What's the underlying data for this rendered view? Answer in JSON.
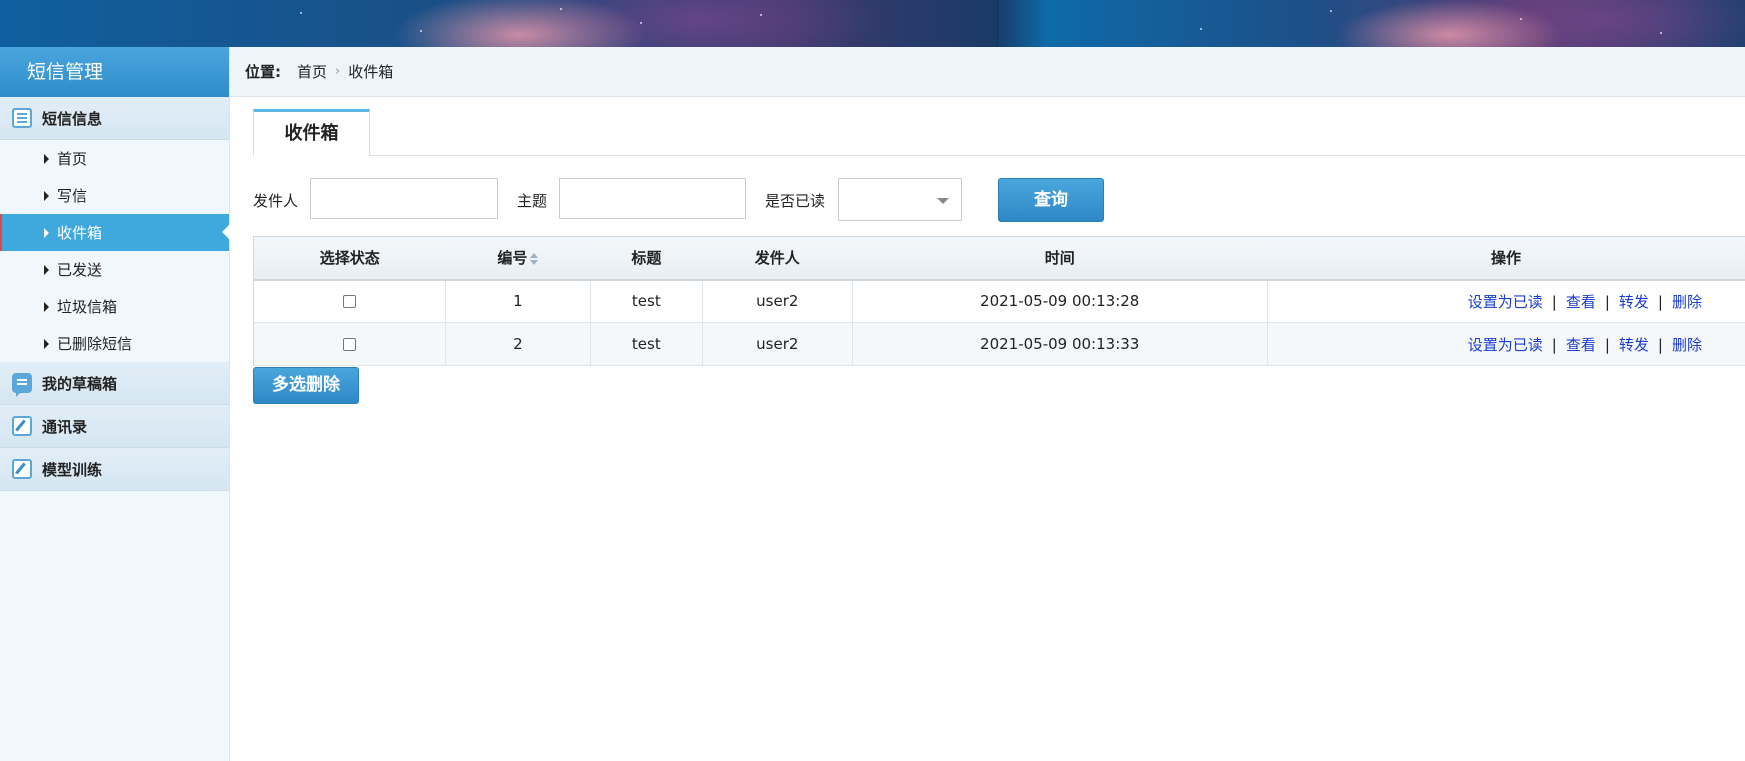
{
  "sidebar": {
    "title": "短信管理",
    "groups": [
      {
        "label": "短信信息",
        "icon": "list-icon"
      },
      {
        "label": "我的草稿箱",
        "icon": "chat-icon"
      },
      {
        "label": "通讯录",
        "icon": "edit-icon"
      },
      {
        "label": "模型训练",
        "icon": "edit-icon"
      }
    ],
    "items": [
      "首页",
      "写信",
      "收件箱",
      "已发送",
      "垃圾信箱",
      "已删除短信"
    ],
    "active_item": "收件箱"
  },
  "breadcrumb": {
    "label": "位置:",
    "path": [
      "首页",
      "收件箱"
    ]
  },
  "tab": {
    "label": "收件箱"
  },
  "search": {
    "sender_label": "发件人",
    "sender_value": "",
    "subject_label": "主题",
    "subject_value": "",
    "read_label": "是否已读",
    "read_value": "",
    "query_button": "查询"
  },
  "table": {
    "headers": [
      "选择状态",
      "编号",
      "标题",
      "发件人",
      "时间",
      "操作"
    ],
    "rows": [
      {
        "id": "1",
        "title": "test",
        "sender": "user2",
        "time": "2021-05-09 00:13:28"
      },
      {
        "id": "2",
        "title": "test",
        "sender": "user2",
        "time": "2021-05-09 00:13:33"
      }
    ],
    "actions": [
      "设置为已读",
      "查看",
      "转发",
      "删除"
    ],
    "action_separator": "|"
  },
  "multi_delete_button": "多选删除",
  "colors": {
    "accent": "#3fa9de",
    "link": "#1a3ccf",
    "sidebar_bg": "#f0f7fd"
  }
}
